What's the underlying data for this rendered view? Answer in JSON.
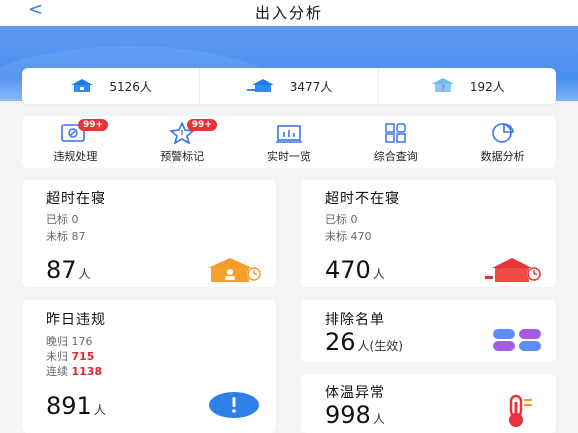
{
  "header": {
    "back": "<",
    "title": "出入分析"
  },
  "stats": [
    {
      "value": "5126人",
      "icon": "blue-house-icon"
    },
    {
      "value": "3477人",
      "icon": "house-inbound-icon"
    },
    {
      "value": "192人",
      "icon": "house-question-icon"
    }
  ],
  "menu": [
    {
      "label": "违规处理",
      "badge": "99+",
      "icon": "violation-card-icon"
    },
    {
      "label": "预警标记",
      "badge": "99+",
      "icon": "warning-star-icon"
    },
    {
      "label": "实时一览",
      "icon": "realtime-chart-icon"
    },
    {
      "label": "综合查询",
      "icon": "query-grid-icon"
    },
    {
      "label": "数据分析",
      "icon": "pie-chart-icon"
    }
  ],
  "cards": {
    "overtime_in": {
      "title": "超时在寝",
      "line1": "已标 0",
      "line2": "未标 87",
      "big": "87",
      "unit": "人"
    },
    "overtime_out": {
      "title": "超时不在寝",
      "line1": "已标 0",
      "line2": "未标 470",
      "big": "470",
      "unit": "人"
    },
    "yesterday": {
      "title": "昨日违规",
      "line1_label": "晚归",
      "line1_value": "176",
      "line2_label": "未归",
      "line2_value": "715",
      "line3_label": "连续",
      "line3_value": "1138",
      "big": "891",
      "unit": "人"
    },
    "exclude": {
      "title": "排除名单",
      "big": "26",
      "unit": "人(生效)"
    },
    "temp": {
      "title": "体温异常",
      "big": "998",
      "unit": "人"
    }
  }
}
